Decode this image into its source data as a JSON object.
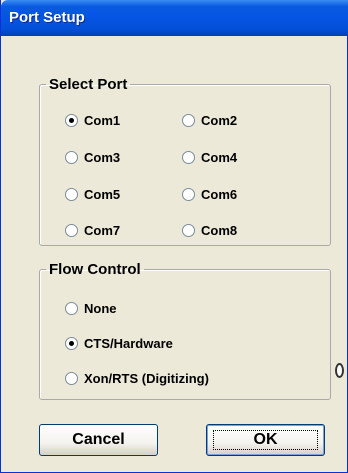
{
  "window": {
    "title": "Port Setup"
  },
  "select_port": {
    "legend": "Select Port",
    "options": [
      {
        "label": "Com1",
        "checked": true
      },
      {
        "label": "Com2",
        "checked": false
      },
      {
        "label": "Com3",
        "checked": false
      },
      {
        "label": "Com4",
        "checked": false
      },
      {
        "label": "Com5",
        "checked": false
      },
      {
        "label": "Com6",
        "checked": false
      },
      {
        "label": "Com7",
        "checked": false
      },
      {
        "label": "Com8",
        "checked": false
      }
    ]
  },
  "flow_control": {
    "legend": "Flow Control",
    "options": [
      {
        "label": "None",
        "checked": false
      },
      {
        "label": "CTS/Hardware",
        "checked": true
      },
      {
        "label": "Xon/RTS (Digitizing)",
        "checked": false
      }
    ]
  },
  "buttons": {
    "cancel": "Cancel",
    "ok": "OK"
  },
  "colors": {
    "titlebar": "#0554E3",
    "dialog_bg": "#ECE9D8",
    "group_border": "#A9A9A9"
  }
}
